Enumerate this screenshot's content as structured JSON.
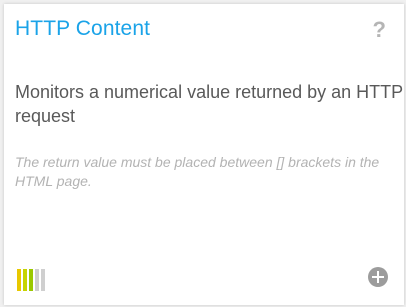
{
  "card": {
    "title": "HTTP Content",
    "help_icon": "?",
    "description": "Monitors a numerical value returned by an HTTP request",
    "note": "The return value must be placed between [] brackets in the HTML page.",
    "level": {
      "filled": 3,
      "total": 5,
      "colors": [
        "#e8c800",
        "#c6d400",
        "#9ac800",
        "#cfcfcf",
        "#cfcfcf"
      ]
    },
    "add_icon": "plus-circle-icon"
  },
  "colors": {
    "title": "#1aa3e8",
    "text": "#595959",
    "note": "#b3b3b3",
    "icon": "#9c9c9c"
  }
}
